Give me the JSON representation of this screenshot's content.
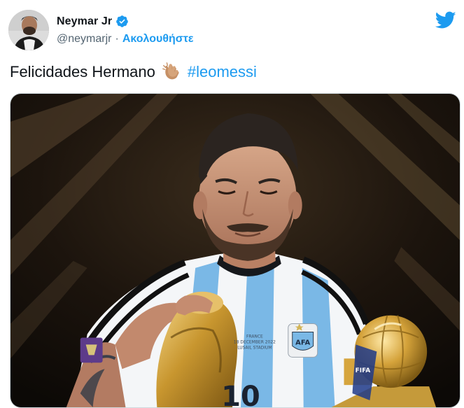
{
  "author": {
    "display_name": "Neymar Jr",
    "handle": "@neymarjr",
    "separator": "·",
    "follow_label": "Ακολουθήστε",
    "verified": true,
    "avatar_icon": "profile-photo"
  },
  "brand": {
    "icon": "twitter-bird-icon",
    "color": "#1d9bf0"
  },
  "tweet": {
    "text": "Felicidades Hermano",
    "emoji": "👏🏽",
    "hashtag": "#leomessi"
  },
  "media": {
    "type": "photo",
    "jersey_patch_text": "FRANCE\n18 DECEMBER 2022\nLUSAIL STADIUM",
    "crest_text": "AFA"
  },
  "colors": {
    "text_primary": "#0f1419",
    "text_secondary": "#536471",
    "link": "#1d9bf0",
    "border": "#cfd9de"
  }
}
